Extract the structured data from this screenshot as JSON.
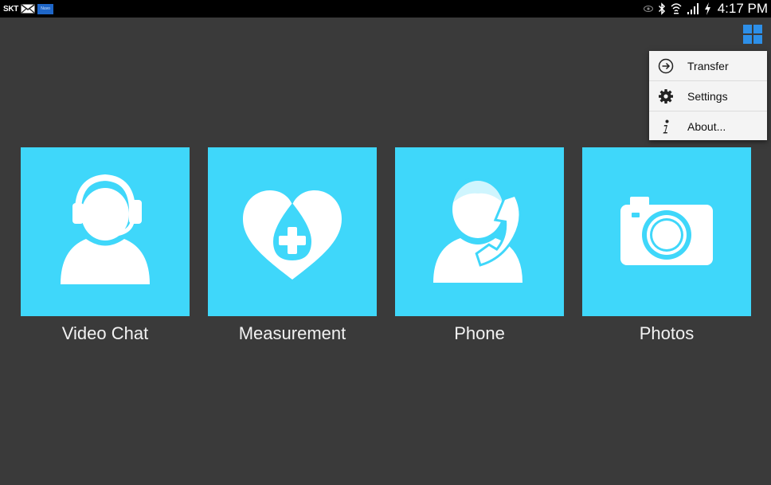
{
  "status_bar": {
    "carrier": "SKT",
    "app_badge_text": "Nuvo",
    "time": "4:17 PM",
    "icons": [
      "mail-icon",
      "app-notification-icon",
      "eye-icon",
      "bluetooth-icon",
      "wifi-icon",
      "signal-icon",
      "battery-charging-icon"
    ]
  },
  "toolbar": {
    "menu_icon": "grid-menu-icon",
    "accent": "#2d8fe8"
  },
  "overflow_menu": {
    "items": [
      {
        "label": "Transfer",
        "icon": "arrow-circle-icon"
      },
      {
        "label": "Settings",
        "icon": "gear-icon"
      },
      {
        "label": "About...",
        "icon": "info-icon"
      }
    ]
  },
  "tiles": [
    {
      "label": "Video Chat",
      "icon": "headset-person-icon"
    },
    {
      "label": "Measurement",
      "icon": "heart-drop-plus-icon"
    },
    {
      "label": "Phone",
      "icon": "person-phone-icon"
    },
    {
      "label": "Photos",
      "icon": "camera-icon"
    }
  ],
  "colors": {
    "background": "#3a3a3a",
    "tile": "#3fd7fa",
    "status_bar": "#000000",
    "menu_bg": "#f4f4f4"
  }
}
